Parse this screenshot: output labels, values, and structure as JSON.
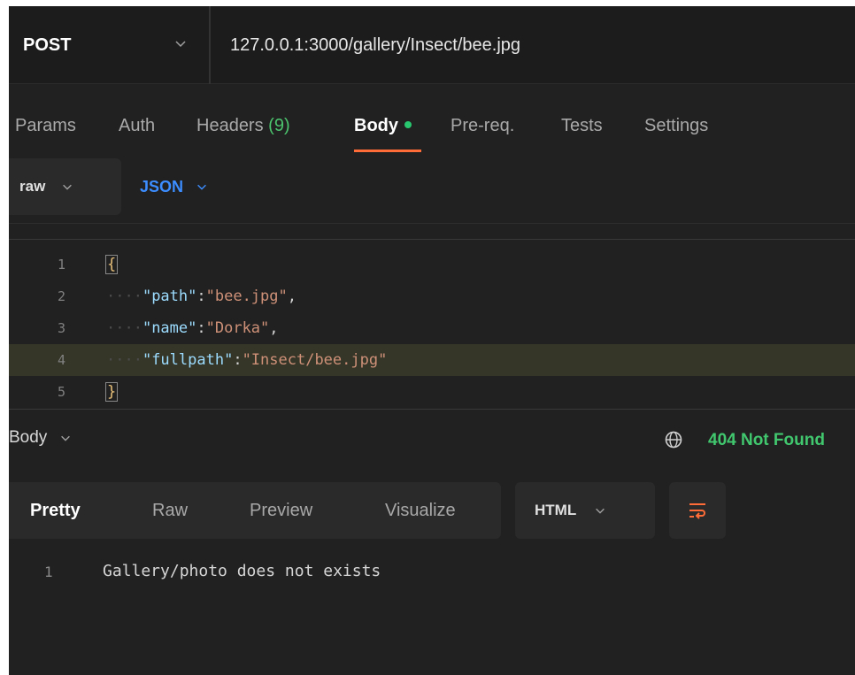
{
  "request": {
    "method": "POST",
    "url": "127.0.0.1:3000/gallery/Insect/bee.jpg"
  },
  "tabs": [
    {
      "label": "Params"
    },
    {
      "label": "Auth"
    },
    {
      "label": "Headers",
      "count": "(9)"
    },
    {
      "label": "Body",
      "active": true
    },
    {
      "label": "Pre-req."
    },
    {
      "label": "Tests"
    },
    {
      "label": "Settings"
    }
  ],
  "body_mode": "raw",
  "body_language": "JSON",
  "editor": {
    "lines": [
      {
        "num": "1",
        "open": "{"
      },
      {
        "num": "2",
        "key": "\"path\"",
        "value": "\"bee.jpg\"",
        "comma": ","
      },
      {
        "num": "3",
        "key": "\"name\"",
        "value": "\"Dorka\"",
        "comma": ","
      },
      {
        "num": "4",
        "key": "\"fullpath\"",
        "value": "\"Insect/bee.jpg\""
      },
      {
        "num": "5",
        "close": "}"
      }
    ]
  },
  "response": {
    "label": "Body",
    "status": "404 Not Found",
    "status_color": "#41c76e",
    "views": [
      {
        "label": "Pretty",
        "active": true
      },
      {
        "label": "Raw"
      },
      {
        "label": "Preview"
      },
      {
        "label": "Visualize"
      }
    ],
    "format": "HTML",
    "lines": [
      {
        "num": "1",
        "text": "Gallery/photo does not exists"
      }
    ]
  },
  "icons": {
    "method_dropdown": "chevron-down-icon",
    "globe": "globe-icon",
    "wrap": "wrap-lines-icon"
  },
  "colors": {
    "accent": "#ff6c37",
    "json_blue": "#3c8dff",
    "background": "#212121"
  }
}
